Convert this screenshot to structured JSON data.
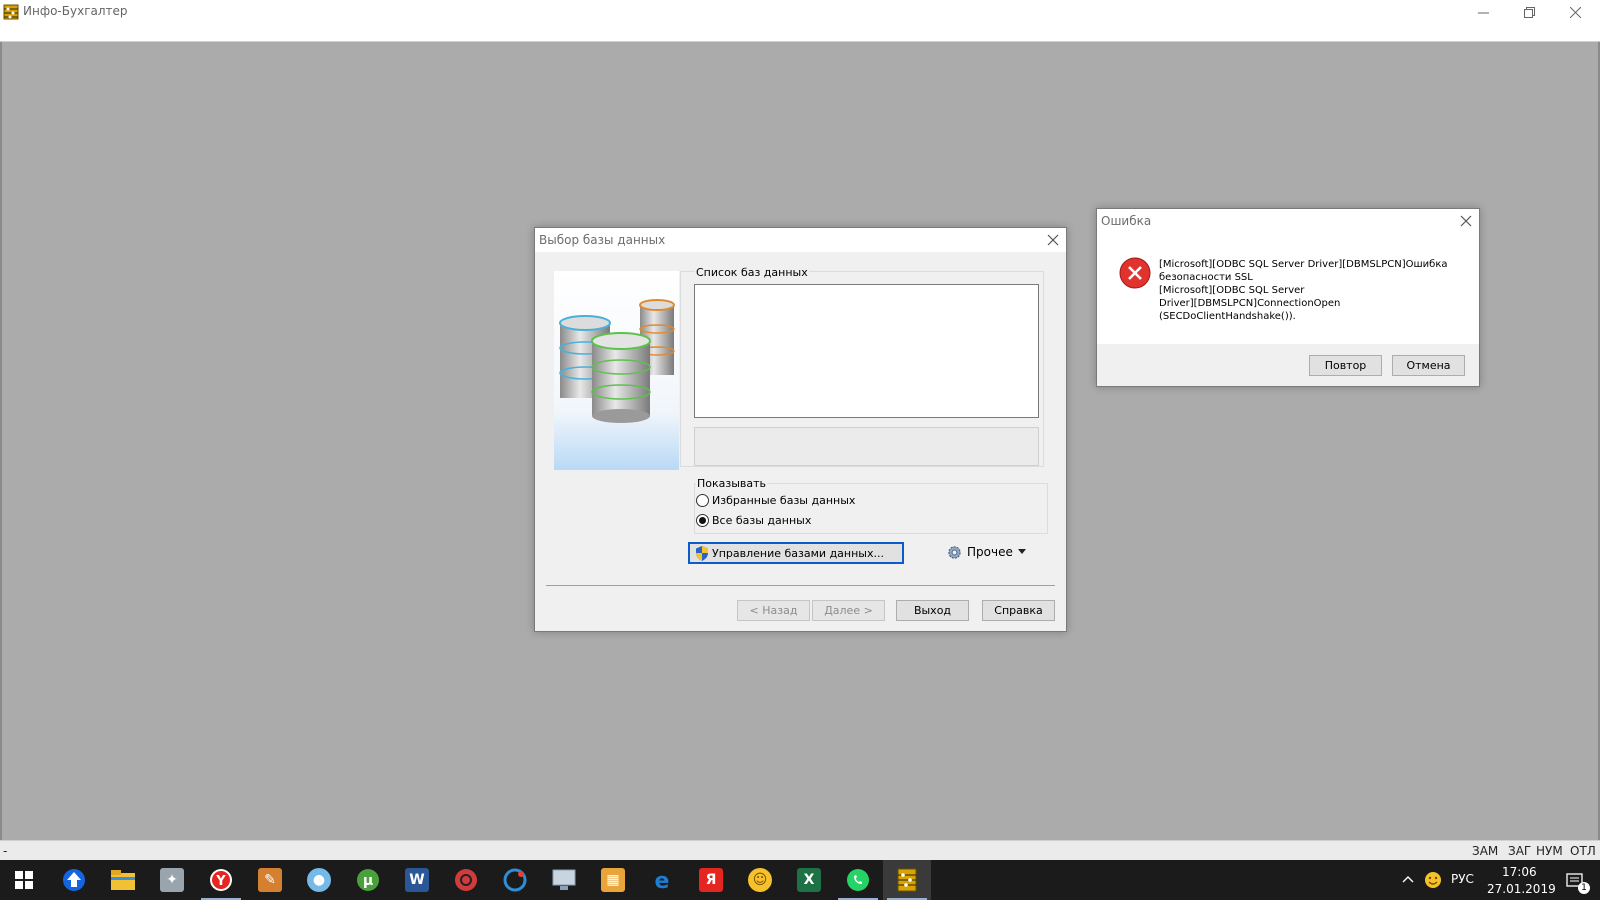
{
  "app": {
    "title": "Инфо-Бухгалтер"
  },
  "db_dialog": {
    "title": "Выбор базы данных",
    "list_label": "Список баз данных",
    "show_label": "Показывать",
    "radio_favorites": "Избранные базы данных",
    "radio_all": "Все базы данных",
    "selected_radio": "all",
    "manage_button": "Управление базами данных...",
    "other_button": "Прочее",
    "back_button": "< Назад",
    "next_button": "Далее >",
    "exit_button": "Выход",
    "help_button": "Справка"
  },
  "error_dialog": {
    "title": "Ошибка",
    "message_lines": [
      "[Microsoft][ODBC SQL Server Driver][DBMSLPCN]Ошибка",
      "безопасности SSL",
      "[Microsoft][ODBC SQL Server",
      "Driver][DBMSLPCN]ConnectionOpen",
      "(SECDoClientHandshake())."
    ],
    "retry_button": "Повтор",
    "cancel_button": "Отмена"
  },
  "statusbar": {
    "left": "-",
    "indicators": [
      "ЗАМ",
      "ЗАГ",
      "НУМ",
      "ОТЛ"
    ]
  },
  "taskbar": {
    "apps": [
      {
        "name": "start-icon",
        "color": "#ffffff"
      },
      {
        "name": "upload-arrow-icon",
        "color": "#1565e0"
      },
      {
        "name": "file-explorer-icon",
        "color": "#f3c034"
      },
      {
        "name": "settings-tool-icon",
        "color": "#9aa4ad"
      },
      {
        "name": "yandex-browser-icon",
        "color": "#e52620"
      },
      {
        "name": "drawing-app-icon",
        "color": "#d58030"
      },
      {
        "name": "paint-icon",
        "color": "#74b9e8"
      },
      {
        "name": "utorrent-icon",
        "color": "#4aa03a"
      },
      {
        "name": "word-icon",
        "color": "#2b5797"
      },
      {
        "name": "media-player-icon",
        "color": "#d23b3b"
      },
      {
        "name": "ccleaner-icon",
        "color": "#2f8fd6"
      },
      {
        "name": "remote-desktop-icon",
        "color": "#8aa0b5"
      },
      {
        "name": "maps-icon",
        "color": "#e9a53a"
      },
      {
        "name": "edge-icon",
        "color": "#1a7fd6"
      },
      {
        "name": "yandex-icon",
        "color": "#e52620"
      },
      {
        "name": "emoji-app-icon",
        "color": "#f5c22b"
      },
      {
        "name": "excel-icon",
        "color": "#1e7145"
      },
      {
        "name": "whatsapp-icon",
        "color": "#25d366"
      },
      {
        "name": "accounting-app-icon",
        "color": "#d9a400"
      }
    ],
    "tray_lang": "РУС",
    "time": "17:06",
    "date": "27.01.2019",
    "notification_count": "1"
  }
}
